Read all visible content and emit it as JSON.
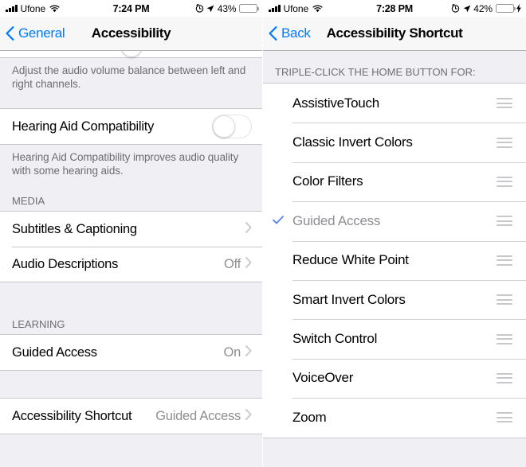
{
  "left": {
    "status": {
      "carrier": "Ufone",
      "signal_bars": 4,
      "wifi_icon": "wifi-icon",
      "time": "7:24 PM",
      "alarm_icon": "alarm-clock-icon",
      "location_icon": "location-arrow-icon",
      "battery_percent": "43%",
      "battery_level": 43,
      "battery_color": "#2B2B2B",
      "charging": false
    },
    "nav": {
      "back_label": "General",
      "back_icon": "chevron-left-icon",
      "title": "Accessibility",
      "tint": "#007AFF"
    },
    "footer_volume_balance": "Adjust the audio volume balance between left and right channels.",
    "hearing_aid": {
      "label": "Hearing Aid Compatibility",
      "toggle_state": "off"
    },
    "footer_hearing_aid": "Hearing Aid Compatibility improves audio quality with some hearing aids.",
    "media_header": "MEDIA",
    "media_rows": [
      {
        "label": "Subtitles & Captioning",
        "value": "",
        "chevron": true
      },
      {
        "label": "Audio Descriptions",
        "value": "Off",
        "chevron": true
      }
    ],
    "learning_header": "LEARNING",
    "learning_rows": [
      {
        "label": "Guided Access",
        "value": "On",
        "chevron": true
      }
    ],
    "shortcut_rows": [
      {
        "label": "Accessibility Shortcut",
        "value": "Guided Access",
        "chevron": true
      }
    ]
  },
  "right": {
    "status": {
      "carrier": "Ufone",
      "signal_bars": 4,
      "wifi_icon": "wifi-icon",
      "time": "7:28 PM",
      "alarm_icon": "alarm-clock-icon",
      "location_icon": "location-arrow-icon",
      "battery_percent": "42%",
      "battery_level": 42,
      "battery_color": "#4CD964",
      "charging": true,
      "charging_icon": "lightning-bolt-icon"
    },
    "nav": {
      "back_label": "Back",
      "back_icon": "chevron-left-icon",
      "title": "Accessibility Shortcut",
      "tint": "#007AFF"
    },
    "section_header": "TRIPLE-CLICK THE HOME BUTTON FOR:",
    "options": [
      {
        "label": "AssistiveTouch",
        "selected": false
      },
      {
        "label": "Classic Invert Colors",
        "selected": false
      },
      {
        "label": "Color Filters",
        "selected": false
      },
      {
        "label": "Guided Access",
        "selected": true
      },
      {
        "label": "Reduce White Point",
        "selected": false
      },
      {
        "label": "Smart Invert Colors",
        "selected": false
      },
      {
        "label": "Switch Control",
        "selected": false
      },
      {
        "label": "VoiceOver",
        "selected": false
      },
      {
        "label": "Zoom",
        "selected": false
      }
    ],
    "reorder_icon": "reorder-handle-icon",
    "check_icon": "checkmark-icon"
  }
}
